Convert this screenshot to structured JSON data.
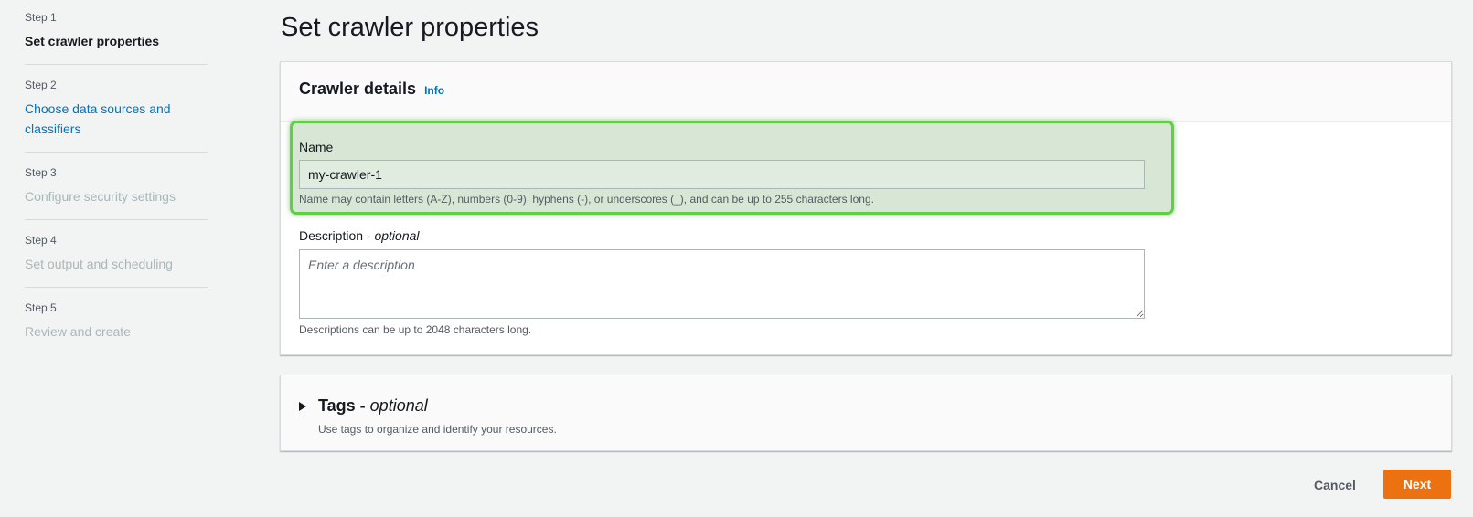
{
  "steps": [
    {
      "num": "Step 1",
      "title": "Set crawler properties",
      "state": "current"
    },
    {
      "num": "Step 2",
      "title": "Choose data sources and classifiers",
      "state": "link"
    },
    {
      "num": "Step 3",
      "title": "Configure security settings",
      "state": "disabled"
    },
    {
      "num": "Step 4",
      "title": "Set output and scheduling",
      "state": "disabled"
    },
    {
      "num": "Step 5",
      "title": "Review and create",
      "state": "disabled"
    }
  ],
  "page_title": "Set crawler properties",
  "details": {
    "title": "Crawler details",
    "info": "Info",
    "name_label": "Name",
    "name_value": "my-crawler-1",
    "name_hint": "Name may contain letters (A-Z), numbers (0-9), hyphens (-), or underscores (_), and can be up to 255 characters long.",
    "desc_label": "Description - ",
    "desc_optional": "optional",
    "desc_placeholder": "Enter a description",
    "desc_hint": "Descriptions can be up to 2048 characters long."
  },
  "tags": {
    "title": "Tags - ",
    "optional": "optional",
    "description": "Use tags to organize and identify your resources."
  },
  "actions": {
    "cancel": "Cancel",
    "next": "Next"
  },
  "colors": {
    "primary": "#ec7211",
    "link": "#0073bb",
    "highlight_border": "#5fd041"
  }
}
